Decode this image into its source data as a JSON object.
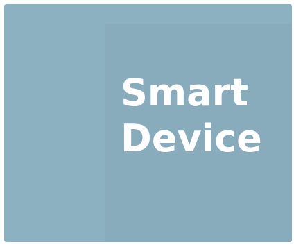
{
  "tile": {
    "title_line_1": "Smart",
    "title_line_2": "Device",
    "background_color": "#8cb2c2",
    "text_color": "#ffffff"
  }
}
